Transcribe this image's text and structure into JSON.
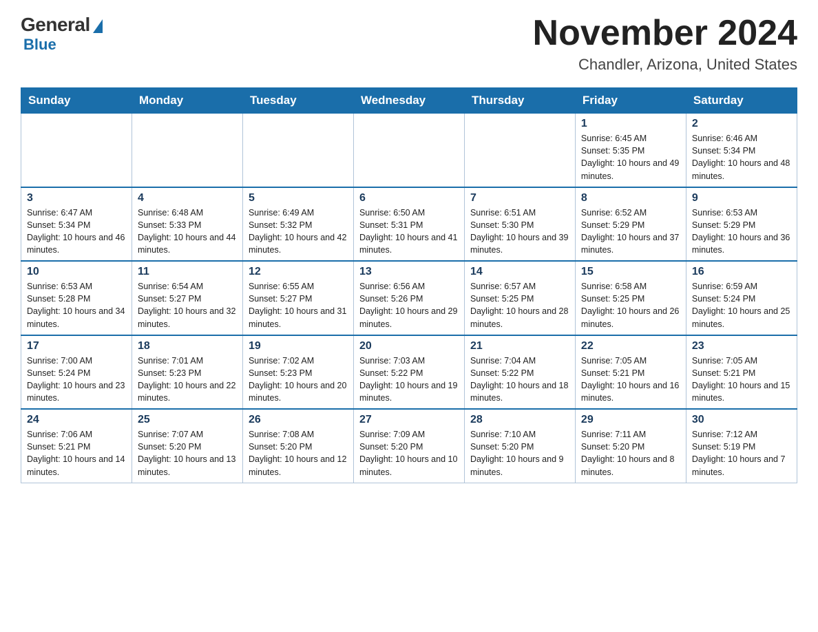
{
  "logo": {
    "general": "General",
    "blue": "Blue",
    "triangle_color": "#1a6eaa"
  },
  "header": {
    "title": "November 2024",
    "location": "Chandler, Arizona, United States"
  },
  "weekdays": [
    "Sunday",
    "Monday",
    "Tuesday",
    "Wednesday",
    "Thursday",
    "Friday",
    "Saturday"
  ],
  "weeks": [
    [
      {
        "day": "",
        "info": ""
      },
      {
        "day": "",
        "info": ""
      },
      {
        "day": "",
        "info": ""
      },
      {
        "day": "",
        "info": ""
      },
      {
        "day": "",
        "info": ""
      },
      {
        "day": "1",
        "info": "Sunrise: 6:45 AM\nSunset: 5:35 PM\nDaylight: 10 hours and 49 minutes."
      },
      {
        "day": "2",
        "info": "Sunrise: 6:46 AM\nSunset: 5:34 PM\nDaylight: 10 hours and 48 minutes."
      }
    ],
    [
      {
        "day": "3",
        "info": "Sunrise: 6:47 AM\nSunset: 5:34 PM\nDaylight: 10 hours and 46 minutes."
      },
      {
        "day": "4",
        "info": "Sunrise: 6:48 AM\nSunset: 5:33 PM\nDaylight: 10 hours and 44 minutes."
      },
      {
        "day": "5",
        "info": "Sunrise: 6:49 AM\nSunset: 5:32 PM\nDaylight: 10 hours and 42 minutes."
      },
      {
        "day": "6",
        "info": "Sunrise: 6:50 AM\nSunset: 5:31 PM\nDaylight: 10 hours and 41 minutes."
      },
      {
        "day": "7",
        "info": "Sunrise: 6:51 AM\nSunset: 5:30 PM\nDaylight: 10 hours and 39 minutes."
      },
      {
        "day": "8",
        "info": "Sunrise: 6:52 AM\nSunset: 5:29 PM\nDaylight: 10 hours and 37 minutes."
      },
      {
        "day": "9",
        "info": "Sunrise: 6:53 AM\nSunset: 5:29 PM\nDaylight: 10 hours and 36 minutes."
      }
    ],
    [
      {
        "day": "10",
        "info": "Sunrise: 6:53 AM\nSunset: 5:28 PM\nDaylight: 10 hours and 34 minutes."
      },
      {
        "day": "11",
        "info": "Sunrise: 6:54 AM\nSunset: 5:27 PM\nDaylight: 10 hours and 32 minutes."
      },
      {
        "day": "12",
        "info": "Sunrise: 6:55 AM\nSunset: 5:27 PM\nDaylight: 10 hours and 31 minutes."
      },
      {
        "day": "13",
        "info": "Sunrise: 6:56 AM\nSunset: 5:26 PM\nDaylight: 10 hours and 29 minutes."
      },
      {
        "day": "14",
        "info": "Sunrise: 6:57 AM\nSunset: 5:25 PM\nDaylight: 10 hours and 28 minutes."
      },
      {
        "day": "15",
        "info": "Sunrise: 6:58 AM\nSunset: 5:25 PM\nDaylight: 10 hours and 26 minutes."
      },
      {
        "day": "16",
        "info": "Sunrise: 6:59 AM\nSunset: 5:24 PM\nDaylight: 10 hours and 25 minutes."
      }
    ],
    [
      {
        "day": "17",
        "info": "Sunrise: 7:00 AM\nSunset: 5:24 PM\nDaylight: 10 hours and 23 minutes."
      },
      {
        "day": "18",
        "info": "Sunrise: 7:01 AM\nSunset: 5:23 PM\nDaylight: 10 hours and 22 minutes."
      },
      {
        "day": "19",
        "info": "Sunrise: 7:02 AM\nSunset: 5:23 PM\nDaylight: 10 hours and 20 minutes."
      },
      {
        "day": "20",
        "info": "Sunrise: 7:03 AM\nSunset: 5:22 PM\nDaylight: 10 hours and 19 minutes."
      },
      {
        "day": "21",
        "info": "Sunrise: 7:04 AM\nSunset: 5:22 PM\nDaylight: 10 hours and 18 minutes."
      },
      {
        "day": "22",
        "info": "Sunrise: 7:05 AM\nSunset: 5:21 PM\nDaylight: 10 hours and 16 minutes."
      },
      {
        "day": "23",
        "info": "Sunrise: 7:05 AM\nSunset: 5:21 PM\nDaylight: 10 hours and 15 minutes."
      }
    ],
    [
      {
        "day": "24",
        "info": "Sunrise: 7:06 AM\nSunset: 5:21 PM\nDaylight: 10 hours and 14 minutes."
      },
      {
        "day": "25",
        "info": "Sunrise: 7:07 AM\nSunset: 5:20 PM\nDaylight: 10 hours and 13 minutes."
      },
      {
        "day": "26",
        "info": "Sunrise: 7:08 AM\nSunset: 5:20 PM\nDaylight: 10 hours and 12 minutes."
      },
      {
        "day": "27",
        "info": "Sunrise: 7:09 AM\nSunset: 5:20 PM\nDaylight: 10 hours and 10 minutes."
      },
      {
        "day": "28",
        "info": "Sunrise: 7:10 AM\nSunset: 5:20 PM\nDaylight: 10 hours and 9 minutes."
      },
      {
        "day": "29",
        "info": "Sunrise: 7:11 AM\nSunset: 5:20 PM\nDaylight: 10 hours and 8 minutes."
      },
      {
        "day": "30",
        "info": "Sunrise: 7:12 AM\nSunset: 5:19 PM\nDaylight: 10 hours and 7 minutes."
      }
    ]
  ]
}
